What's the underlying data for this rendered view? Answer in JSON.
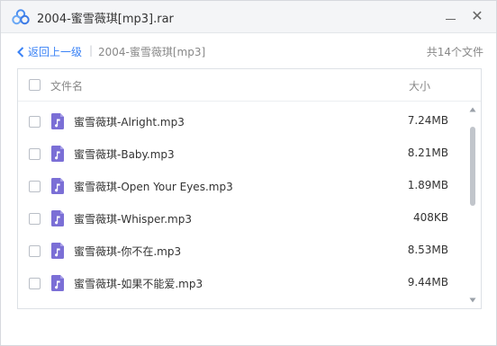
{
  "window": {
    "title": "2004-蜜雪薇琪[mp3].rar",
    "minimize_icon": "minimize-icon",
    "close_icon": "close-icon",
    "close_glyph": "✕"
  },
  "nav": {
    "back_label": "返回上一级",
    "separator": "|",
    "current_folder": "2004-蜜雪薇琪[mp3]",
    "file_count": "共14个文件"
  },
  "table": {
    "columns": {
      "name": "文件名",
      "size": "大小"
    },
    "rows": [
      {
        "name": "蜜雪薇琪-Alright.mp3",
        "size": "7.24MB"
      },
      {
        "name": "蜜雪薇琪-Baby.mp3",
        "size": "8.21MB"
      },
      {
        "name": "蜜雪薇琪-Open Your Eyes.mp3",
        "size": "1.89MB"
      },
      {
        "name": "蜜雪薇琪-Whisper.mp3",
        "size": "408KB"
      },
      {
        "name": "蜜雪薇琪-你不在.mp3",
        "size": "8.53MB"
      },
      {
        "name": "蜜雪薇琪-如果不能爱.mp3",
        "size": "9.44MB"
      }
    ]
  },
  "colors": {
    "accent": "#3a82f6",
    "file_icon": "#7b6fd6",
    "titlebar_bg": "#f4f5f7"
  },
  "icons": {
    "app": "cloud-logo-icon",
    "back": "chevron-left-icon",
    "file": "music-file-icon"
  }
}
